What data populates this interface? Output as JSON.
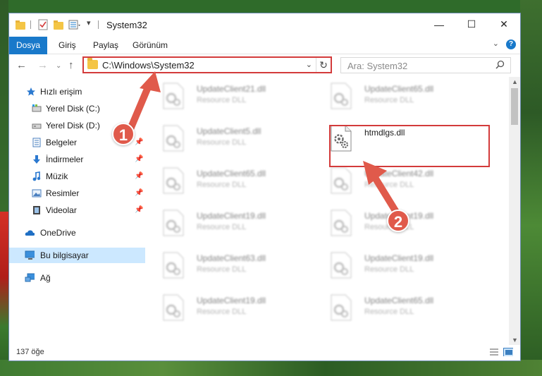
{
  "window": {
    "title": "System32",
    "controls": {
      "minimize": "—",
      "maximize": "☐",
      "close": "✕"
    }
  },
  "ribbon": {
    "tabs": [
      "Dosya",
      "Giriş",
      "Paylaş",
      "Görünüm"
    ],
    "help": "?"
  },
  "navigation": {
    "address_path": "C:\\Windows\\System32",
    "search_placeholder": "Ara: System32"
  },
  "sidebar": {
    "items": [
      {
        "label": "Hızlı erişim",
        "icon": "star-icon",
        "pinned": false
      },
      {
        "label": "Yerel Disk (C:)",
        "icon": "drive-icon",
        "pinned": true
      },
      {
        "label": "Yerel Disk (D:)",
        "icon": "drive-icon",
        "pinned": true
      },
      {
        "label": "Belgeler",
        "icon": "documents-icon",
        "pinned": true
      },
      {
        "label": "İndirmeler",
        "icon": "download-icon",
        "pinned": true
      },
      {
        "label": "Müzik",
        "icon": "music-icon",
        "pinned": true
      },
      {
        "label": "Resimler",
        "icon": "pictures-icon",
        "pinned": true
      },
      {
        "label": "Videolar",
        "icon": "video-icon",
        "pinned": true
      },
      {
        "label": "OneDrive",
        "icon": "cloud-icon",
        "pinned": false
      },
      {
        "label": "Bu bilgisayar",
        "icon": "computer-icon",
        "pinned": false,
        "selected": true
      },
      {
        "label": "Ağ",
        "icon": "network-icon",
        "pinned": false
      }
    ],
    "pin_glyph": "📌"
  },
  "files": {
    "left_column": [
      {
        "name": "UpdateClient21.dll",
        "type": "Resource DLL"
      },
      {
        "name": "UpdateClient5.dll",
        "type": "Resource DLL"
      },
      {
        "name": "UpdateClient65.dll",
        "type": "Resource DLL"
      },
      {
        "name": "UpdateClient19.dll",
        "type": "Resource DLL"
      },
      {
        "name": "UpdateClient63.dll",
        "type": "Resource DLL"
      },
      {
        "name": "UpdateClient19.dll",
        "type": "Resource DLL"
      }
    ],
    "right_column": [
      {
        "name": "UpdateClient65.dll",
        "type": "Resource DLL"
      },
      {
        "name": "htmdlgs.dll",
        "type": "",
        "highlighted": true
      },
      {
        "name": "UpdateClient42.dll",
        "type": "Resource DLL"
      },
      {
        "name": "UpdateClient19.dll",
        "type": "Resource DLL"
      },
      {
        "name": "UpdateClient19.dll",
        "type": "Resource DLL"
      },
      {
        "name": "UpdateClient65.dll",
        "type": "Resource DLL"
      }
    ]
  },
  "status": {
    "item_count": "137 öğe"
  },
  "annotations": {
    "step1": "1",
    "step2": "2",
    "color": "#e05a4b"
  },
  "colors": {
    "accent": "#1979ca",
    "highlight_border": "#d33b3b",
    "selected_bg": "#cce8ff"
  }
}
